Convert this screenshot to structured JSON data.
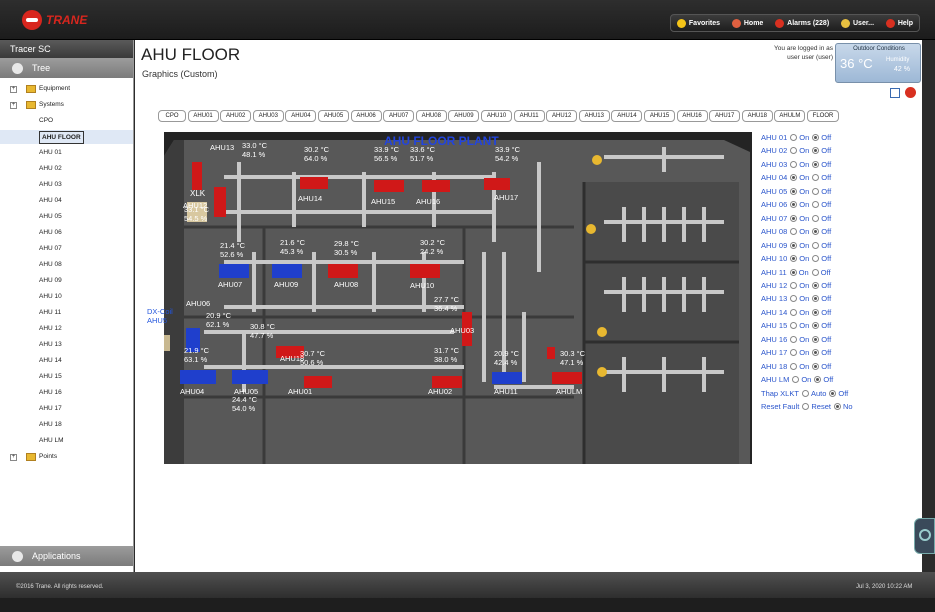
{
  "topbar": {
    "brand": "TRANE",
    "nav": [
      {
        "label": "Favorites",
        "icon": "star-icon",
        "color": "#f5c518"
      },
      {
        "label": "Home",
        "icon": "home-icon",
        "color": "#e06040"
      },
      {
        "label": "Alarms (228)",
        "icon": "alarm-icon",
        "color": "#d83020"
      },
      {
        "label": "User...",
        "icon": "user-icon",
        "color": "#e8c040"
      },
      {
        "label": "Help",
        "icon": "help-icon",
        "color": "#d83020"
      }
    ]
  },
  "sidebar": {
    "header": "Tracer SC",
    "tree_label": "Tree",
    "apps_label": "Applications",
    "items": [
      {
        "label": "Equipment",
        "type": "folder"
      },
      {
        "label": "Systems",
        "type": "folder"
      },
      {
        "label": "CPO",
        "type": "leaf"
      },
      {
        "label": "AHU FLOOR",
        "type": "leaf",
        "selected": true
      },
      {
        "label": "AHU 01",
        "type": "leaf"
      },
      {
        "label": "AHU 02",
        "type": "leaf"
      },
      {
        "label": "AHU 03",
        "type": "leaf"
      },
      {
        "label": "AHU 04",
        "type": "leaf"
      },
      {
        "label": "AHU 05",
        "type": "leaf"
      },
      {
        "label": "AHU 06",
        "type": "leaf"
      },
      {
        "label": "AHU 07",
        "type": "leaf"
      },
      {
        "label": "AHU 08",
        "type": "leaf"
      },
      {
        "label": "AHU 09",
        "type": "leaf"
      },
      {
        "label": "AHU 10",
        "type": "leaf"
      },
      {
        "label": "AHU 11",
        "type": "leaf"
      },
      {
        "label": "AHU 12",
        "type": "leaf"
      },
      {
        "label": "AHU 13",
        "type": "leaf"
      },
      {
        "label": "AHU 14",
        "type": "leaf"
      },
      {
        "label": "AHU 15",
        "type": "leaf"
      },
      {
        "label": "AHU 16",
        "type": "leaf"
      },
      {
        "label": "AHU 17",
        "type": "leaf"
      },
      {
        "label": "AHU 18",
        "type": "leaf"
      },
      {
        "label": "AHU LM",
        "type": "leaf"
      },
      {
        "label": "Points",
        "type": "folder"
      }
    ]
  },
  "main": {
    "title": "AHU FLOOR",
    "subtitle": "Graphics (Custom)",
    "login_line1": "You are logged in as",
    "login_line2": "user user (user)",
    "outdoor": {
      "header": "Outdoor Conditions",
      "temp": "36 °C",
      "humidity_label": "Humidity",
      "humidity": "42 %"
    },
    "tabs": [
      "CPO",
      "AHU01",
      "AHU02",
      "AHU03",
      "AHU04",
      "AHU05",
      "AHU06",
      "AHU07",
      "AHU08",
      "AHU09",
      "AHU10",
      "AHU11",
      "AHU12",
      "AHU13",
      "AHU14",
      "AHU15",
      "AHU16",
      "AHU17",
      "AHU18",
      "AHULM",
      "FLOOR"
    ]
  },
  "plan": {
    "title": "AHU FLOOR PLANT",
    "xlk_label": "XLK",
    "dx_label1": "DX-Coil",
    "dx_label2": "AHU5",
    "units": [
      {
        "name": "AHU13",
        "temp": "33.0 °C",
        "hum": "48.1 %",
        "state": "on"
      },
      {
        "name": "AHU12",
        "temp": "33.1 °C",
        "hum": "54.5 %",
        "state": "on"
      },
      {
        "name": "AHU14",
        "temp": "30.2 °C",
        "hum": "64.0 %",
        "state": "on"
      },
      {
        "name": "AHU15",
        "temp": "33.9 °C",
        "hum": "56.5 %",
        "state": "on"
      },
      {
        "name": "AHU16",
        "temp": "33.6 °C",
        "hum": "51.7 %",
        "state": "on"
      },
      {
        "name": "AHU17",
        "temp": "33.9 °C",
        "hum": "54.2 %",
        "state": "on"
      },
      {
        "name": "AHU07",
        "temp": "21.4 °C",
        "hum": "52.6 %",
        "state": "off"
      },
      {
        "name": "AHU09",
        "temp": "21.6 °C",
        "hum": "45.3 %",
        "state": "off"
      },
      {
        "name": "AHU08",
        "temp": "29.8 °C",
        "hum": "30.5 %",
        "state": "on"
      },
      {
        "name": "AHU10",
        "temp": "30.2 °C",
        "hum": "24.2 %",
        "state": "on"
      },
      {
        "name": "AHU06",
        "temp": "20.9 °C",
        "hum": "62.1 %",
        "state": "off"
      },
      {
        "name": "AHU03",
        "temp": "27.7 °C",
        "hum": "36.4 %",
        "state": "on"
      },
      {
        "name": "AHU18",
        "temp": "30.8 °C",
        "hum": "47.7 %",
        "state": "on"
      },
      {
        "name": "AHU04",
        "temp": "21.9 °C",
        "hum": "63.1 %",
        "state": "off"
      },
      {
        "name": "AHU05",
        "temp": "24.4 °C",
        "hum": "54.0 %",
        "state": "off"
      },
      {
        "name": "AHU01",
        "temp": "30.7 °C",
        "hum": "50.6 %",
        "state": "on"
      },
      {
        "name": "AHU02",
        "temp": "31.7 °C",
        "hum": "38.0 %",
        "state": "on"
      },
      {
        "name": "AHU11",
        "temp": "20.9 °C",
        "hum": "42.4 %",
        "state": "off"
      },
      {
        "name": "AHULM",
        "temp": "30.3 °C",
        "hum": "47.1 %",
        "state": "on"
      }
    ]
  },
  "controls": {
    "on_label": "On",
    "off_label": "Off",
    "rows": [
      {
        "label": "AHU 01",
        "value": "Off"
      },
      {
        "label": "AHU 02",
        "value": "Off"
      },
      {
        "label": "AHU 03",
        "value": "Off"
      },
      {
        "label": "AHU 04",
        "value": "On"
      },
      {
        "label": "AHU 05",
        "value": "On"
      },
      {
        "label": "AHU 06",
        "value": "On"
      },
      {
        "label": "AHU 07",
        "value": "On"
      },
      {
        "label": "AHU 08",
        "value": "Off"
      },
      {
        "label": "AHU 09",
        "value": "On"
      },
      {
        "label": "AHU 10",
        "value": "On"
      },
      {
        "label": "AHU 11",
        "value": "On"
      },
      {
        "label": "AHU 12",
        "value": "Off"
      },
      {
        "label": "AHU 13",
        "value": "Off"
      },
      {
        "label": "AHU 14",
        "value": "Off"
      },
      {
        "label": "AHU 15",
        "value": "Off"
      },
      {
        "label": "AHU 16",
        "value": "Off"
      },
      {
        "label": "AHU 17",
        "value": "Off"
      },
      {
        "label": "AHU 18",
        "value": "Off"
      },
      {
        "label": "AHU LM",
        "value": "Off"
      }
    ],
    "thap": {
      "label": "Thap XLKT",
      "opt1": "Auto",
      "opt2": "Off",
      "value": "Off"
    },
    "reset": {
      "label": "Reset Fault",
      "opt1": "Reset",
      "opt2": "No",
      "value": "No"
    }
  },
  "footer": {
    "copyright": "©2016 Trane. All rights reserved.",
    "timestamp": "Jul 3, 2020 10:22 AM"
  }
}
